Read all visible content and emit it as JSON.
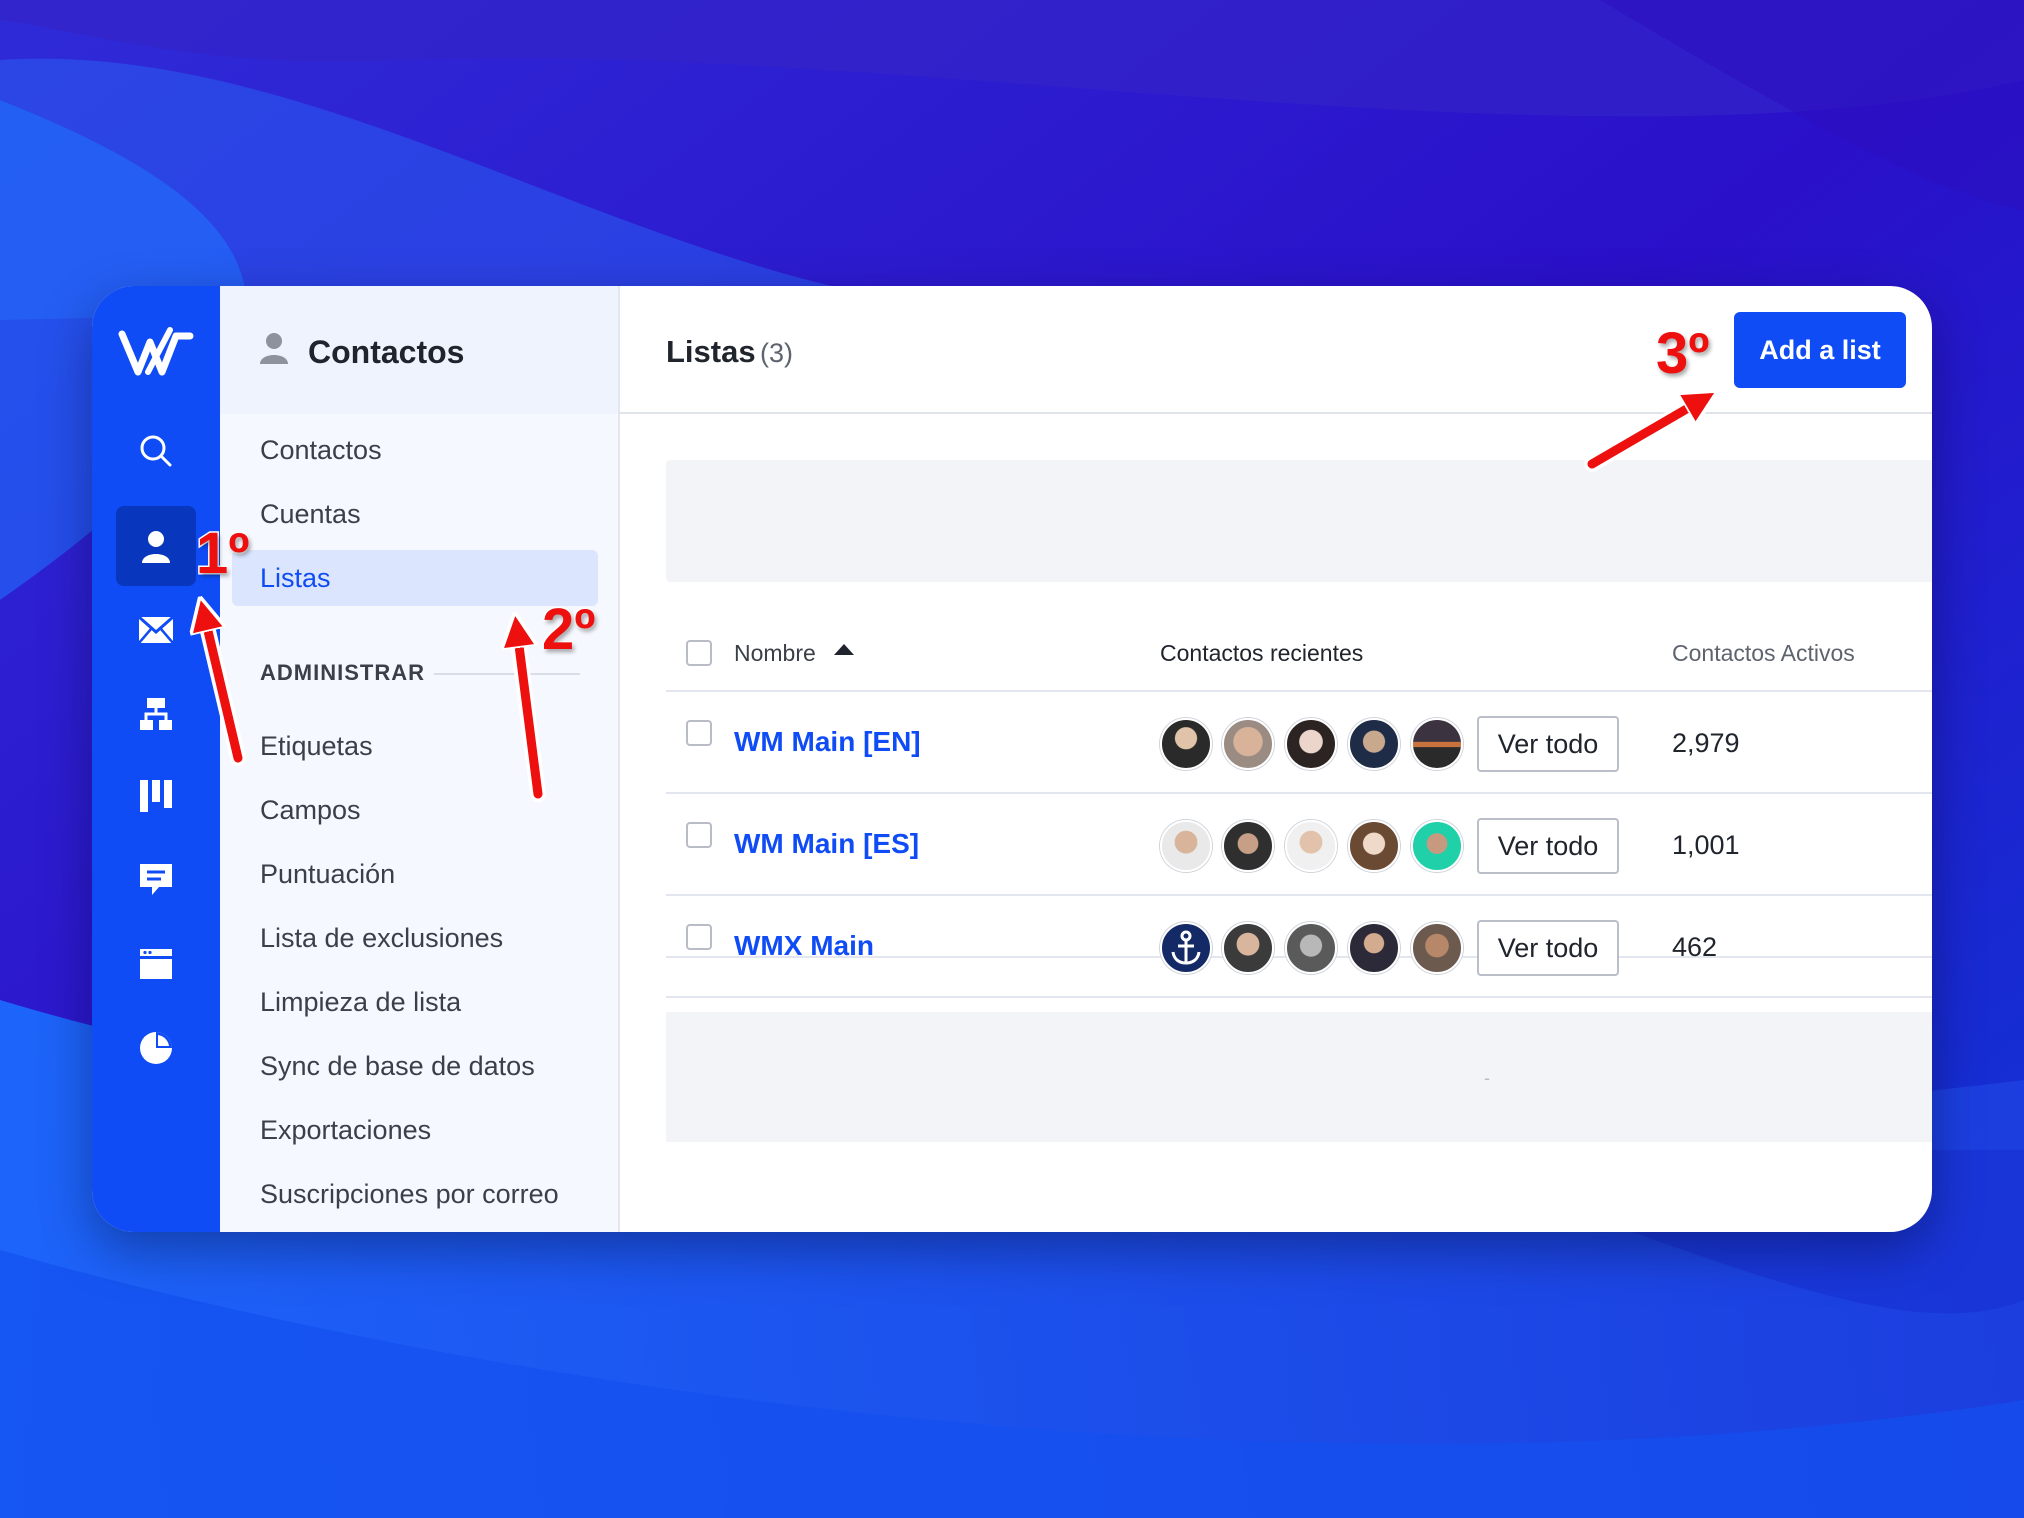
{
  "colors": {
    "brand": "#0f4cf5",
    "rail_active": "#0836bd",
    "annotation": "#ee0f0f"
  },
  "rail": {
    "logo_icon": "wm-logo-icon",
    "icons": [
      "search-icon",
      "contacts-icon",
      "email-icon",
      "automation-icon",
      "pipeline-icon",
      "conversations-icon",
      "website-icon",
      "reports-icon"
    ],
    "active": "contacts-icon"
  },
  "subnav": {
    "title": "Contactos",
    "items": [
      {
        "label": "Contactos"
      },
      {
        "label": "Cuentas"
      },
      {
        "label": "Listas"
      }
    ],
    "section_label": "ADMINISTRAR",
    "admin_items": [
      {
        "label": "Etiquetas"
      },
      {
        "label": "Campos"
      },
      {
        "label": "Puntuación"
      },
      {
        "label": "Lista de exclusiones"
      },
      {
        "label": "Limpieza de lista"
      },
      {
        "label": "Sync de base de datos"
      },
      {
        "label": "Exportaciones"
      },
      {
        "label": "Suscripciones por correo"
      }
    ],
    "active_item": "Listas"
  },
  "main": {
    "title": "Listas",
    "count": "(3)",
    "add_button": "Add a list",
    "table": {
      "headers": {
        "name": "Nombre",
        "recent": "Contactos recientes",
        "active": "Contactos Activos"
      },
      "rows": [
        {
          "name": "WM Main [EN]",
          "view_all": "Ver todo",
          "active_contacts": "2,979"
        },
        {
          "name": "WM Main [ES]",
          "view_all": "Ver todo",
          "active_contacts": "1,001"
        },
        {
          "name": "WMX Main",
          "view_all": "Ver todo",
          "active_contacts": "462"
        }
      ]
    },
    "empty_placeholder": "-"
  },
  "annotations": {
    "step1": "1º",
    "step2": "2º",
    "step3": "3º"
  }
}
